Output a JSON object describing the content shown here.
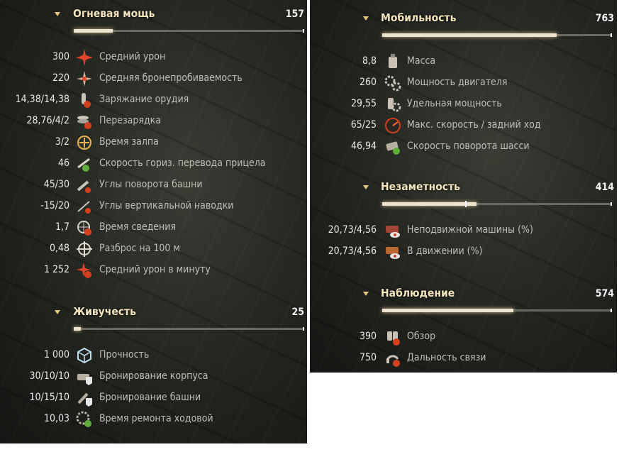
{
  "left": {
    "firepower": {
      "title": "Огневая мощь",
      "value": "157",
      "bar": 0.17,
      "rows": [
        {
          "value": "300",
          "label": "Средний урон",
          "icon": "damage-icon"
        },
        {
          "value": "220",
          "label": "Средняя бронепробиваемость",
          "icon": "penetration-icon"
        },
        {
          "value": "14,38/14,38",
          "label": "Заряжание орудия",
          "icon": "loading-icon"
        },
        {
          "value": "28,76/4/2",
          "label": "Перезарядка",
          "icon": "reload-icon"
        },
        {
          "value": "3/2",
          "label": "Время залпа",
          "icon": "salvo-time-icon"
        },
        {
          "value": "46",
          "label": "Скорость гориз. перевода прицела",
          "icon": "traverse-icon"
        },
        {
          "value": "45/30",
          "label": "Углы поворота башни",
          "icon": "turret-angle-icon"
        },
        {
          "value": "-15/20",
          "label": "Углы вертикальной наводки",
          "icon": "elevation-icon"
        },
        {
          "value": "1,7",
          "label": "Время сведения",
          "icon": "aim-time-icon"
        },
        {
          "value": "0,48",
          "label": "Разброс на 100 м",
          "icon": "dispersion-icon"
        },
        {
          "value": "1 252",
          "label": "Средний урон в минуту",
          "icon": "dpm-icon"
        }
      ]
    },
    "survivability": {
      "title": "Живучесть",
      "value": "25",
      "bar": 0.03,
      "rows": [
        {
          "value": "1 000",
          "label": "Прочность",
          "icon": "hp-cube-icon"
        },
        {
          "value": "30/10/10",
          "label": "Бронирование корпуса",
          "icon": "hull-armor-icon"
        },
        {
          "value": "10/15/10",
          "label": "Бронирование башни",
          "icon": "turret-armor-icon"
        },
        {
          "value": "10,03",
          "label": "Время ремонта ходовой",
          "icon": "repair-icon"
        }
      ]
    }
  },
  "right": {
    "mobility": {
      "title": "Мобильность",
      "value": "763",
      "bar": 0.76,
      "rows": [
        {
          "value": "8,8",
          "label": "Масса",
          "icon": "weight-icon"
        },
        {
          "value": "260",
          "label": "Мощность двигателя",
          "icon": "engine-gears-icon"
        },
        {
          "value": "29,55",
          "label": "Удельная мощность",
          "icon": "specific-power-icon"
        },
        {
          "value": "65/25",
          "label": "Макс. скорость / задний ход",
          "icon": "speedometer-icon"
        },
        {
          "value": "46,94",
          "label": "Скорость поворота шасси",
          "icon": "hull-traverse-icon"
        }
      ]
    },
    "concealment": {
      "title": "Незаметность",
      "value": "414",
      "bar": 0.41,
      "tick": 0.36,
      "rows": [
        {
          "value": "20,73/4,56",
          "label": "Неподвижной машины (%)",
          "icon": "stationary-camo-icon"
        },
        {
          "value": "20,73/4,56",
          "label": "В движении (%)",
          "icon": "moving-camo-icon"
        }
      ]
    },
    "spotting": {
      "title": "Наблюдение",
      "value": "574",
      "bar": 0.57,
      "rows": [
        {
          "value": "390",
          "label": "Обзор",
          "icon": "view-range-icon"
        },
        {
          "value": "750",
          "label": "Дальность связи",
          "icon": "radio-range-icon"
        }
      ]
    }
  }
}
